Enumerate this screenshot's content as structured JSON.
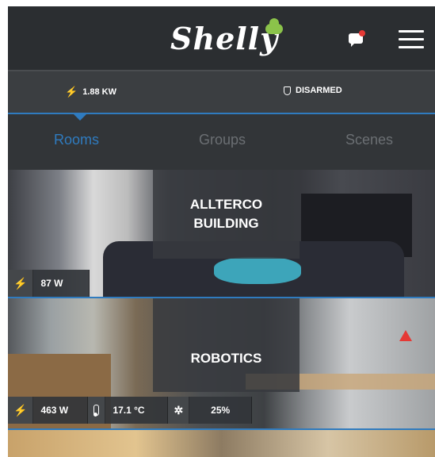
{
  "header": {
    "logo_text": "Shelly",
    "notifications_icon": "chat-bubble-icon",
    "menu_icon": "hamburger-menu-icon"
  },
  "status": {
    "power": "1.88 KW",
    "security": "DISARMED"
  },
  "tabs": [
    {
      "label": "Rooms",
      "active": true
    },
    {
      "label": "Groups",
      "active": false
    },
    {
      "label": "Scenes",
      "active": false
    }
  ],
  "rooms": [
    {
      "name_line1": "ALLTERCO",
      "name_line2": "BUILDING",
      "power": "87 W"
    },
    {
      "name": "ROBOTICS",
      "power": "463 W",
      "temperature": "17.1 °C",
      "humidity": "25%"
    }
  ],
  "colors": {
    "accent": "#2f7bbf",
    "header_bg": "#2b2e31",
    "notification_dot": "#e53935",
    "logo_cloud": "#8bc34a"
  }
}
